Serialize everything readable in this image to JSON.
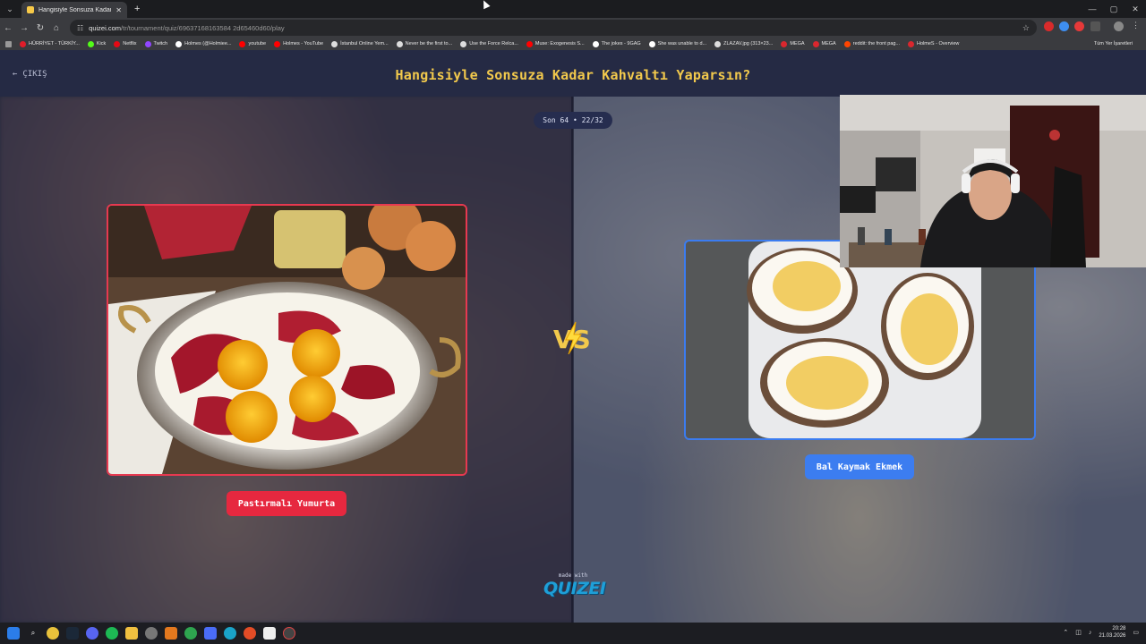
{
  "browser": {
    "tab_title": "Hangisiyle Sonsuza Kadar Kahv...",
    "tab_close": "✕",
    "new_tab": "+",
    "url_host": "quizei.com",
    "url_path": "/tr/tournament/quiz/69637168163584 2d65460d60/play",
    "window_controls": [
      "—",
      "▢",
      "✕"
    ],
    "bookmarks": [
      {
        "label": "HÜRRİYET - TÜRKİY...",
        "color": "#e11d2a"
      },
      {
        "label": "Kick",
        "color": "#53fc18"
      },
      {
        "label": "Netflix",
        "color": "#e50914"
      },
      {
        "label": "Twitch",
        "color": "#9146ff"
      },
      {
        "label": "Holmes (@Holmiee...",
        "color": "#ffffff"
      },
      {
        "label": "youtube",
        "color": "#ff0000"
      },
      {
        "label": "Holmes - YouTube",
        "color": "#ff0000"
      },
      {
        "label": "İstanbul Online Yem...",
        "color": "#dddddd"
      },
      {
        "label": "Never be the first to...",
        "color": "#dddddd"
      },
      {
        "label": "Use the Force Relca...",
        "color": "#dddddd"
      },
      {
        "label": "Muse: Exogenesis S...",
        "color": "#ff0000"
      },
      {
        "label": "The jokes - 9GAG",
        "color": "#ffffff"
      },
      {
        "label": "She was unable to d...",
        "color": "#ffffff"
      },
      {
        "label": "ZLAZAV.jpg (313×23...",
        "color": "#dddddd"
      },
      {
        "label": "MEGA",
        "color": "#d9272e"
      },
      {
        "label": "MEGA",
        "color": "#d9272e"
      },
      {
        "label": "reddit: the front pag...",
        "color": "#ff4500"
      },
      {
        "label": "HolmeS - Overview",
        "color": "#d9272e"
      }
    ],
    "all_bookmarks": "Tüm Yer İşaretleri"
  },
  "app": {
    "exit_label": "ÇIKIŞ",
    "title": "Hangisiyle Sonsuza Kadar Kahvaltı Yaparsın?",
    "round": "Son 64 • 22/32",
    "left_choice": "Pastırmalı Yumurta",
    "right_choice": "Bal Kaymak Ekmek",
    "vs": "VS",
    "made_with": "made with",
    "brand": "QUIZEI"
  },
  "taskbar": {
    "time": "20:28",
    "date": "21.03.2026"
  },
  "colors": {
    "accent_yellow": "#f2c94c",
    "left_red": "#e6283f",
    "right_blue": "#3c7df0"
  }
}
